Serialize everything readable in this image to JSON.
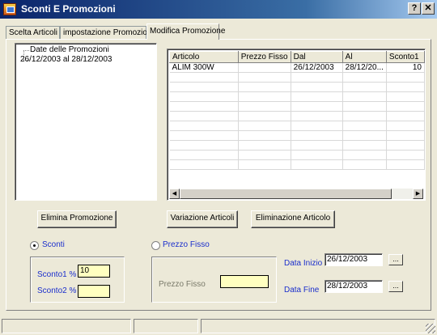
{
  "window": {
    "title": "Sconti E Promozioni",
    "help_label": "?",
    "close_label": "✕"
  },
  "tabs": [
    {
      "label": "Scelta Articoli"
    },
    {
      "label": "impostazione Promozione"
    },
    {
      "label": "Modifica Promozione",
      "active": true
    }
  ],
  "tree": {
    "root": "Date delle Promozioni",
    "child": "26/12/2003 al 28/12/2003"
  },
  "grid": {
    "columns": [
      "Articolo",
      "Prezzo Fisso",
      "Dal",
      "Al",
      "Sconto1"
    ],
    "rows": [
      [
        "ALIM 300W",
        "",
        "26/12/2003",
        "28/12/20...",
        "10"
      ]
    ]
  },
  "buttons": {
    "elimina_promozione": "Elimina Promozione",
    "variazione_articoli": "Variazione Articoli",
    "eliminazione_articolo": "Eliminazione Articolo",
    "date_picker": "..."
  },
  "sconti": {
    "radio_label": "Sconti",
    "sconto1_label": "Sconto1 %",
    "sconto1_value": "10",
    "sconto2_label": "Sconto2 %",
    "sconto2_value": ""
  },
  "prezzo_fisso": {
    "radio_label": "Prezzo Fisso",
    "field_label": "Prezzo Fisso",
    "field_value": ""
  },
  "dates": {
    "inizio_label": "Data Inizio",
    "inizio_value": "26/12/2003",
    "fine_label": "Data Fine",
    "fine_value": "28/12/2003"
  },
  "colors": {
    "title_bar": "#0a246a",
    "label_blue": "#1a2ecc",
    "field_yellow": "#ffffc0"
  }
}
